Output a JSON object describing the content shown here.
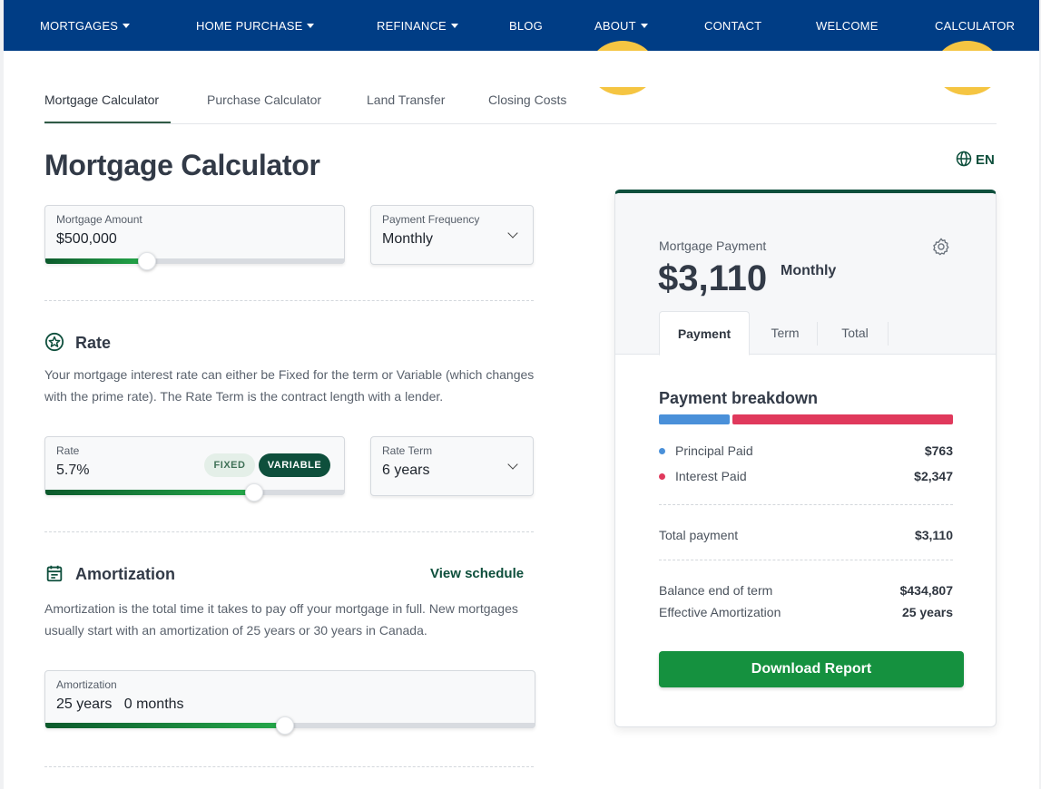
{
  "nav": {
    "items": [
      {
        "label": "MORTGAGES",
        "dropdown": true
      },
      {
        "label": "HOME PURCHASE",
        "dropdown": true
      },
      {
        "label": "REFINANCE",
        "dropdown": true
      },
      {
        "label": "BLOG",
        "dropdown": false
      },
      {
        "label": "ABOUT",
        "dropdown": true
      },
      {
        "label": "CONTACT",
        "dropdown": false
      },
      {
        "label": "WELCOME",
        "dropdown": false
      },
      {
        "label": "CALCULATOR",
        "dropdown": false
      }
    ],
    "bg_color": "#003d85"
  },
  "tabs": [
    "Mortgage Calculator",
    "Purchase Calculator",
    "Land Transfer",
    "Closing Costs"
  ],
  "page_title": "Mortgage Calculator",
  "language": "EN",
  "mortgage_amount": {
    "label": "Mortgage Amount",
    "value": "$500,000",
    "slider_fraction": 0.34
  },
  "payment_frequency": {
    "label": "Payment Frequency",
    "value": "Monthly"
  },
  "rate_section": {
    "heading": "Rate",
    "description": "Your mortgage interest rate can either be Fixed for the term or Variable (which changes with the prime rate). The Rate Term is the contract length with a lender.",
    "rate": {
      "label": "Rate",
      "value": "5.7%",
      "slider_fraction": 0.7,
      "fixed_label": "FIXED",
      "variable_label": "VARIABLE",
      "selected": "VARIABLE"
    },
    "rate_term": {
      "label": "Rate Term",
      "value": "6 years"
    }
  },
  "amortization_section": {
    "heading": "Amortization",
    "link": "View schedule",
    "description": "Amortization is the total time it takes to pay off your mortgage in full. New mortgages usually start with an amortization of 25 years or 30 years in Canada.",
    "field": {
      "label": "Amortization",
      "years": "25 years",
      "months": "0 months",
      "slider_fraction": 0.49
    }
  },
  "result": {
    "label": "Mortgage Payment",
    "amount": "$3,110",
    "frequency": "Monthly",
    "tabs": [
      "Payment",
      "Term",
      "Total"
    ],
    "breakdown_title": "Payment breakdown",
    "principal": {
      "label": "Principal Paid",
      "value": "$763",
      "color": "#4a90d9"
    },
    "interest": {
      "label": "Interest Paid",
      "value": "$2,347",
      "color": "#e0395c"
    },
    "total": {
      "label": "Total payment",
      "value": "$3,110"
    },
    "balance": {
      "label": "Balance end of term",
      "value": "$434,807"
    },
    "effective_amortization": {
      "label": "Effective Amortization",
      "value": "25 years"
    },
    "download_label": "Download Report",
    "accent_color": "#0e4f3c",
    "button_color": "#15913f"
  }
}
